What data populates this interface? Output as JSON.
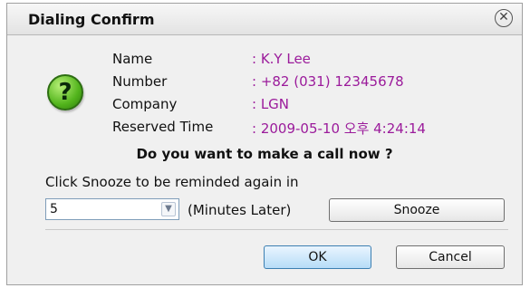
{
  "dialog": {
    "title": "Dialing Confirm",
    "close_icon": "close-icon"
  },
  "info": {
    "icon": "question-icon",
    "help_glyph": "?",
    "fields": [
      {
        "label": "Name",
        "value": ": K.Y Lee"
      },
      {
        "label": "Number",
        "value": ": +82 (031) 12345678"
      },
      {
        "label": "Company",
        "value": ": LGN"
      },
      {
        "label": "Reserved Time",
        "value": ": 2009-05-10 오후 4:24:14"
      }
    ],
    "value_color": "#9b1b9b"
  },
  "question": "Do you want to make a call now ?",
  "snooze": {
    "prompt": "Click Snooze to be reminded again in",
    "selected_minutes": "5",
    "unit_label": "(Minutes Later)",
    "button_label": "Snooze"
  },
  "actions": {
    "ok_label": "OK",
    "cancel_label": "Cancel"
  }
}
